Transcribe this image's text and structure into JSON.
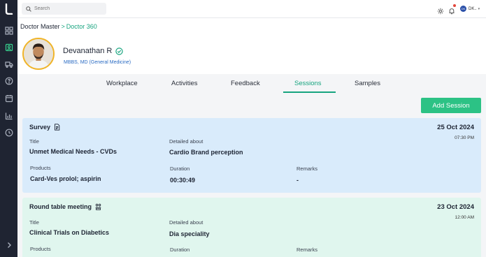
{
  "sidebar": {
    "icons": [
      "logo-icon",
      "dashboard-icon",
      "doctor-icon",
      "truck-icon",
      "help-icon",
      "calendar-icon",
      "chart-icon",
      "clock-icon",
      "chevron-right-icon"
    ],
    "active_index": 2
  },
  "topbar": {
    "search_placeholder": "Search",
    "user_initials": "DK",
    "user_name": "DK.."
  },
  "breadcrumb": {
    "root": "Doctor Master",
    "separator": ">",
    "current": "Doctor 360"
  },
  "doctor": {
    "name": "Devanathan R",
    "degree": "MBBS, MD (General Medicine)"
  },
  "tabs": [
    {
      "label": "Workplace"
    },
    {
      "label": "Activities"
    },
    {
      "label": "Feedback"
    },
    {
      "label": "Sessions"
    },
    {
      "label": "Samples"
    }
  ],
  "active_tab": "Sessions",
  "add_session_label": "Add Session",
  "labels": {
    "title": "Title",
    "detailed_about": "Detailed about",
    "products": "Products",
    "duration": "Duration",
    "remarks": "Remarks"
  },
  "sessions": [
    {
      "type": "Survey",
      "date": "25 Oct 2024",
      "time": "07:30 PM",
      "title": "Unmet Medical Needs - CVDs",
      "detailed_about": "Cardio Brand perception",
      "products": "Card-Ves prolol; aspirin",
      "duration": "00:30:49",
      "remarks": "-",
      "bg_color": "#d9ebfb"
    },
    {
      "type": "Round table meeting",
      "date": "23 Oct 2024",
      "time": "12:00 AM",
      "title": "Clinical Trials on Diabetics",
      "detailed_about": "Dia speciality",
      "bg_color": "#e0f6ee"
    }
  ],
  "colors": {
    "accent": "#17a47f",
    "button": "#2cc285",
    "sidebar": "#1f2432",
    "link": "#2a6bc3"
  }
}
